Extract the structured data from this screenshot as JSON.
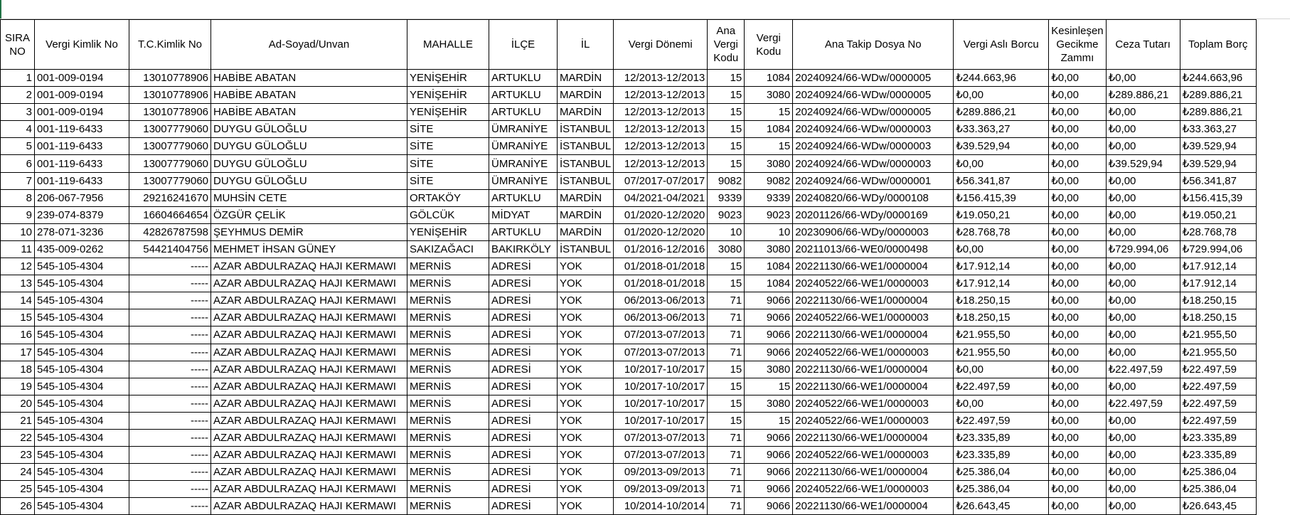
{
  "headers": [
    "SIRA NO",
    "Vergi Kimlik No",
    "T.C.Kimlik No",
    "Ad-Soyad/Unvan",
    "MAHALLE",
    "İLÇE",
    "İL",
    "Vergi Dönemi",
    "Ana Vergi Kodu",
    "Vergi Kodu",
    "Ana Takip Dosya No",
    "Vergi Aslı Borcu",
    "Kesinleşen Gecikme Zammı",
    "Ceza Tutarı",
    "Toplam Borç"
  ],
  "rows": [
    [
      "1",
      "001-009-0194",
      "13010778906",
      "HABİBE ABATAN",
      "YENİŞEHİR",
      "ARTUKLU",
      "MARDİN",
      "12/2013-12/2013",
      "15",
      "1084",
      "20240924/66-WDw/0000005",
      "₺244.663,96",
      "₺0,00",
      "₺0,00",
      "₺244.663,96"
    ],
    [
      "2",
      "001-009-0194",
      "13010778906",
      "HABİBE ABATAN",
      "YENİŞEHİR",
      "ARTUKLU",
      "MARDİN",
      "12/2013-12/2013",
      "15",
      "3080",
      "20240924/66-WDw/0000005",
      "₺0,00",
      "₺0,00",
      "₺289.886,21",
      "₺289.886,21"
    ],
    [
      "3",
      "001-009-0194",
      "13010778906",
      "HABİBE ABATAN",
      "YENİŞEHİR",
      "ARTUKLU",
      "MARDİN",
      "12/2013-12/2013",
      "15",
      "15",
      "20240924/66-WDw/0000005",
      "₺289.886,21",
      "₺0,00",
      "₺0,00",
      "₺289.886,21"
    ],
    [
      "4",
      "001-119-6433",
      "13007779060",
      "DUYGU GÜLOĞLU",
      "SİTE",
      "ÜMRANİYE",
      "İSTANBUL",
      "12/2013-12/2013",
      "15",
      "1084",
      "20240924/66-WDw/0000003",
      "₺33.363,27",
      "₺0,00",
      "₺0,00",
      "₺33.363,27"
    ],
    [
      "5",
      "001-119-6433",
      "13007779060",
      "DUYGU GÜLOĞLU",
      "SİTE",
      "ÜMRANİYE",
      "İSTANBUL",
      "12/2013-12/2013",
      "15",
      "15",
      "20240924/66-WDw/0000003",
      "₺39.529,94",
      "₺0,00",
      "₺0,00",
      "₺39.529,94"
    ],
    [
      "6",
      "001-119-6433",
      "13007779060",
      "DUYGU GÜLOĞLU",
      "SİTE",
      "ÜMRANİYE",
      "İSTANBUL",
      "12/2013-12/2013",
      "15",
      "3080",
      "20240924/66-WDw/0000003",
      "₺0,00",
      "₺0,00",
      "₺39.529,94",
      "₺39.529,94"
    ],
    [
      "7",
      "001-119-6433",
      "13007779060",
      "DUYGU GÜLOĞLU",
      "SİTE",
      "ÜMRANİYE",
      "İSTANBUL",
      "07/2017-07/2017",
      "9082",
      "9082",
      "20240924/66-WDw/0000001",
      "₺56.341,87",
      "₺0,00",
      "₺0,00",
      "₺56.341,87"
    ],
    [
      "8",
      "206-067-7956",
      "29216241670",
      "MUHSİN CETE",
      "ORTAKÖY",
      "ARTUKLU",
      "MARDİN",
      "04/2021-04/2021",
      "9339",
      "9339",
      "20240820/66-WDy/0000108",
      "₺156.415,39",
      "₺0,00",
      "₺0,00",
      "₺156.415,39"
    ],
    [
      "9",
      "239-074-8379",
      "16604664654",
      "ÖZGÜR ÇELİK",
      "GÖLCÜK",
      "MİDYAT",
      "MARDİN",
      "01/2020-12/2020",
      "9023",
      "9023",
      "20201126/66-WDy/0000169",
      "₺19.050,21",
      "₺0,00",
      "₺0,00",
      "₺19.050,21"
    ],
    [
      "10",
      "278-071-3236",
      "42826787598",
      "ŞEYHMUS DEMİR",
      "YENİŞEHİR",
      "ARTUKLU",
      "MARDİN",
      "01/2020-12/2020",
      "10",
      "10",
      "20230906/66-WDy/0000003",
      "₺28.768,78",
      "₺0,00",
      "₺0,00",
      "₺28.768,78"
    ],
    [
      "11",
      "435-009-0262",
      "54421404756",
      "MEHMET İHSAN GÜNEY",
      "SAKIZAĞACI",
      "BAKIRKÖLY",
      "İSTANBUL",
      "01/2016-12/2016",
      "3080",
      "3080",
      "20211013/66-WE0/0000498",
      "₺0,00",
      "₺0,00",
      "₺729.994,06",
      "₺729.994,06"
    ],
    [
      "12",
      "545-105-4304",
      "-----",
      "AZAR ABDULRAZAQ HAJI KERMAWI",
      "MERNİS",
      "ADRESİ",
      "YOK",
      "01/2018-01/2018",
      "15",
      "1084",
      "20221130/66-WE1/0000004",
      "₺17.912,14",
      "₺0,00",
      "₺0,00",
      "₺17.912,14"
    ],
    [
      "13",
      "545-105-4304",
      "-----",
      "AZAR ABDULRAZAQ HAJI KERMAWI",
      "MERNİS",
      "ADRESİ",
      "YOK",
      "01/2018-01/2018",
      "15",
      "1084",
      "20240522/66-WE1/0000003",
      "₺17.912,14",
      "₺0,00",
      "₺0,00",
      "₺17.912,14"
    ],
    [
      "14",
      "545-105-4304",
      "-----",
      "AZAR ABDULRAZAQ HAJI KERMAWI",
      "MERNİS",
      "ADRESİ",
      "YOK",
      "06/2013-06/2013",
      "71",
      "9066",
      "20221130/66-WE1/0000004",
      "₺18.250,15",
      "₺0,00",
      "₺0,00",
      "₺18.250,15"
    ],
    [
      "15",
      "545-105-4304",
      "-----",
      "AZAR ABDULRAZAQ HAJI KERMAWI",
      "MERNİS",
      "ADRESİ",
      "YOK",
      "06/2013-06/2013",
      "71",
      "9066",
      "20240522/66-WE1/0000003",
      "₺18.250,15",
      "₺0,00",
      "₺0,00",
      "₺18.250,15"
    ],
    [
      "16",
      "545-105-4304",
      "-----",
      "AZAR ABDULRAZAQ HAJI KERMAWI",
      "MERNİS",
      "ADRESİ",
      "YOK",
      "07/2013-07/2013",
      "71",
      "9066",
      "20221130/66-WE1/0000004",
      "₺21.955,50",
      "₺0,00",
      "₺0,00",
      "₺21.955,50"
    ],
    [
      "17",
      "545-105-4304",
      "-----",
      "AZAR ABDULRAZAQ HAJI KERMAWI",
      "MERNİS",
      "ADRESİ",
      "YOK",
      "07/2013-07/2013",
      "71",
      "9066",
      "20240522/66-WE1/0000003",
      "₺21.955,50",
      "₺0,00",
      "₺0,00",
      "₺21.955,50"
    ],
    [
      "18",
      "545-105-4304",
      "-----",
      "AZAR ABDULRAZAQ HAJI KERMAWI",
      "MERNİS",
      "ADRESİ",
      "YOK",
      "10/2017-10/2017",
      "15",
      "3080",
      "20221130/66-WE1/0000004",
      "₺0,00",
      "₺0,00",
      "₺22.497,59",
      "₺22.497,59"
    ],
    [
      "19",
      "545-105-4304",
      "-----",
      "AZAR ABDULRAZAQ HAJI KERMAWI",
      "MERNİS",
      "ADRESİ",
      "YOK",
      "10/2017-10/2017",
      "15",
      "15",
      "20221130/66-WE1/0000004",
      "₺22.497,59",
      "₺0,00",
      "₺0,00",
      "₺22.497,59"
    ],
    [
      "20",
      "545-105-4304",
      "-----",
      "AZAR ABDULRAZAQ HAJI KERMAWI",
      "MERNİS",
      "ADRESİ",
      "YOK",
      "10/2017-10/2017",
      "15",
      "3080",
      "20240522/66-WE1/0000003",
      "₺0,00",
      "₺0,00",
      "₺22.497,59",
      "₺22.497,59"
    ],
    [
      "21",
      "545-105-4304",
      "-----",
      "AZAR ABDULRAZAQ HAJI KERMAWI",
      "MERNİS",
      "ADRESİ",
      "YOK",
      "10/2017-10/2017",
      "15",
      "15",
      "20240522/66-WE1/0000003",
      "₺22.497,59",
      "₺0,00",
      "₺0,00",
      "₺22.497,59"
    ],
    [
      "22",
      "545-105-4304",
      "-----",
      "AZAR ABDULRAZAQ HAJI KERMAWI",
      "MERNİS",
      "ADRESİ",
      "YOK",
      "07/2013-07/2013",
      "71",
      "9066",
      "20221130/66-WE1/0000004",
      "₺23.335,89",
      "₺0,00",
      "₺0,00",
      "₺23.335,89"
    ],
    [
      "23",
      "545-105-4304",
      "-----",
      "AZAR ABDULRAZAQ HAJI KERMAWI",
      "MERNİS",
      "ADRESİ",
      "YOK",
      "07/2013-07/2013",
      "71",
      "9066",
      "20240522/66-WE1/0000003",
      "₺23.335,89",
      "₺0,00",
      "₺0,00",
      "₺23.335,89"
    ],
    [
      "24",
      "545-105-4304",
      "-----",
      "AZAR ABDULRAZAQ HAJI KERMAWI",
      "MERNİS",
      "ADRESİ",
      "YOK",
      "09/2013-09/2013",
      "71",
      "9066",
      "20221130/66-WE1/0000004",
      "₺25.386,04",
      "₺0,00",
      "₺0,00",
      "₺25.386,04"
    ],
    [
      "25",
      "545-105-4304",
      "-----",
      "AZAR ABDULRAZAQ HAJI KERMAWI",
      "MERNİS",
      "ADRESİ",
      "YOK",
      "09/2013-09/2013",
      "71",
      "9066",
      "20240522/66-WE1/0000003",
      "₺25.386,04",
      "₺0,00",
      "₺0,00",
      "₺25.386,04"
    ],
    [
      "26",
      "545-105-4304",
      "-----",
      "AZAR ABDULRAZAQ HAJI KERMAWI",
      "MERNİS",
      "ADRESİ",
      "YOK",
      "10/2014-10/2014",
      "71",
      "9066",
      "20221130/66-WE1/0000004",
      "₺26.643,45",
      "₺0,00",
      "₺0,00",
      "₺26.643,45"
    ]
  ]
}
